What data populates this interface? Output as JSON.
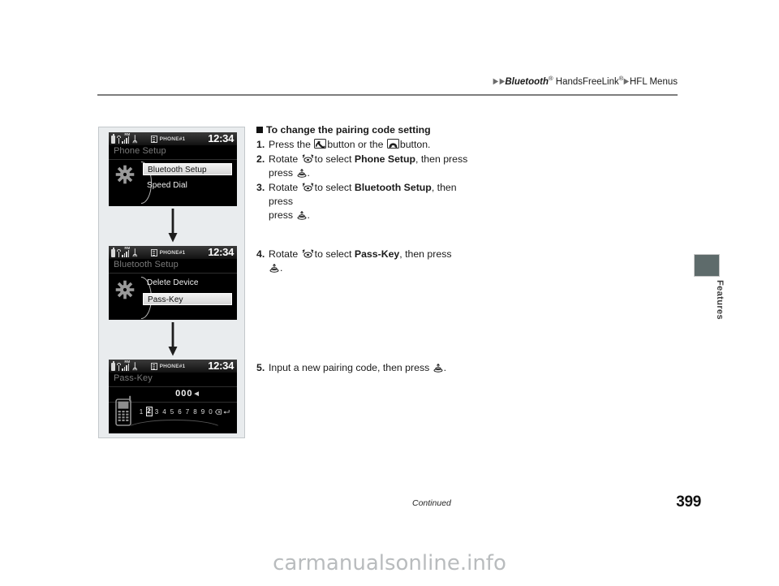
{
  "header": {
    "breadcrumb_arrow": "▶",
    "crumb_1": "Bluetooth",
    "crumb_1_sup": "®",
    "crumb_2": "HandsFreeLink",
    "crumb_2_sup": "®",
    "crumb_3": "HFL Menus"
  },
  "side_tab": {
    "label": "Features",
    "color": "#5e6b6b"
  },
  "instructions": {
    "section_heading": "To change the pairing code setting",
    "step1": {
      "num": "1.",
      "text_a": "Press the",
      "icon_a": "phone-handset-button-icon",
      "text_b": "button or the",
      "icon_b": "phone-hangup-button-icon",
      "text_c": "button."
    },
    "step2": {
      "num": "2.",
      "text_a": "Rotate",
      "icon_a": "rotary-knob-icon",
      "text_b": "to select",
      "target": "Phone Setup",
      "text_c": ", then press",
      "icon_b": "enter-knob-icon",
      "text_d": "."
    },
    "step3": {
      "num": "3.",
      "text_a": "Rotate",
      "icon_a": "rotary-knob-icon",
      "text_b": "to select",
      "target": "Bluetooth Setup",
      "text_c": ", then press",
      "icon_b": "enter-knob-icon",
      "text_d": "."
    },
    "step4": {
      "num": "4.",
      "text_a": "Rotate",
      "icon_a": "rotary-knob-icon",
      "text_b": "to select",
      "target": "Pass-Key",
      "text_c": ", then press",
      "icon_b": "enter-knob-icon",
      "text_d": "."
    },
    "step5": {
      "num": "5.",
      "text_a": "Input a new pairing code, then press",
      "icon_a": "enter-knob-icon",
      "text_b": "."
    }
  },
  "screens": [
    {
      "id": "phone-setup",
      "status": {
        "battery": "battery-icon",
        "signal": "signal-bars-icon",
        "roaming": "RM",
        "bluetooth": "ᛦ",
        "sim": "sim-card-icon",
        "phone_label": "PHONE#1",
        "clock": "12:34"
      },
      "title": "Phone Setup",
      "glyph": "gear-icon",
      "items": [
        {
          "label": "Bluetooth Setup",
          "selected": true
        },
        {
          "label": "Speed Dial",
          "selected": false
        }
      ]
    },
    {
      "id": "bluetooth-setup",
      "status": {
        "battery": "battery-icon",
        "signal": "signal-bars-icon",
        "roaming": "RM",
        "bluetooth": "ᛦ",
        "sim": "sim-card-icon",
        "phone_label": "PHONE#1",
        "clock": "12:34"
      },
      "title": "Bluetooth Setup",
      "glyph": "gear-icon",
      "items": [
        {
          "label": "Delete Device",
          "selected": false
        },
        {
          "label": "Pass-Key",
          "selected": true
        }
      ]
    },
    {
      "id": "pass-key",
      "status": {
        "battery": "battery-icon",
        "signal": "signal-bars-icon",
        "roaming": "RM",
        "bluetooth": "ᛦ",
        "sim": "sim-card-icon",
        "phone_label": "PHONE#1",
        "clock": "12:34"
      },
      "title": "Pass-Key",
      "glyph": "mobile-phone-icon",
      "code_value": "000",
      "code_cursor": "◀",
      "keypad": [
        "1",
        "2",
        "3",
        "4",
        "5",
        "6",
        "7",
        "8",
        "9",
        "0"
      ],
      "keypad_selected": "2",
      "keypad_backspace": "backspace-icon",
      "keypad_enter": "enter-return-icon"
    }
  ],
  "flow": {
    "arrow_1": "down-arrow-icon",
    "arrow_2": "down-arrow-icon"
  },
  "footer": {
    "continued": "Continued",
    "page_number": "399",
    "watermark": "carmanualsonline.info"
  }
}
